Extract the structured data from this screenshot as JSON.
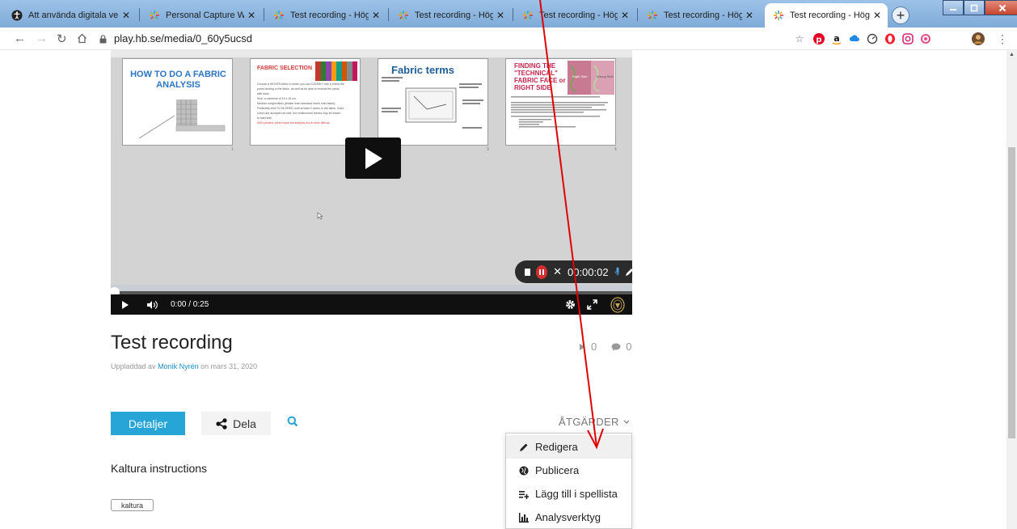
{
  "browser": {
    "tabs": [
      {
        "title": "Att använda digitala ver",
        "favicon": "accessibility-icon"
      },
      {
        "title": "Personal Capture Walkt",
        "favicon": "kaltura-icon"
      },
      {
        "title": "Test recording - Högsk",
        "favicon": "kaltura-icon"
      },
      {
        "title": "Test recording - Högsk",
        "favicon": "kaltura-icon"
      },
      {
        "title": "Test recording - Högsk",
        "favicon": "kaltura-icon"
      },
      {
        "title": "Test recording - Högsk",
        "favicon": "kaltura-icon"
      },
      {
        "title": "Test recording - Högsk",
        "favicon": "kaltura-icon",
        "active": true
      }
    ],
    "tab_close_glyph": "✕",
    "new_tab_glyph": "+",
    "url": "play.hb.se/media/0_60y5ucsd"
  },
  "player": {
    "slides": [
      {
        "title": "HOW TO DO A FABRIC ANALYSIS",
        "number": "1"
      },
      {
        "title": "FABRIC SELECTION",
        "number": "2",
        "bullets": [
          "Choose a WOVEN fabric in which you can CLEARLY see & follow the",
          "yarns binding in the fabric, as well as be able to remove the yarns",
          "with ease",
          "",
          "Size: a minimum of 15 x 15 cm.",
          "",
          "Medium weight fabric (thicker than standard man's shirt fabric).",
          "",
          "Preferably MULTICOLORED, with at least 2 colors in the fabric. Solid",
          "colors are accepted as well, but multicolored fabrics may be easier",
          "to start with.",
          "",
          "NON-printed, prints make the analysis much more difficult."
        ]
      },
      {
        "title": "Fabric terms",
        "number": "3"
      },
      {
        "title": "FINDING THE \"TECHNICAL\" FABRIC FACE or RIGHT SIDE",
        "number": "4",
        "label_right": "Right Side",
        "label_wrong": "Wrong Side"
      }
    ],
    "recorder_time": "00:00:02",
    "time_current": "0:00",
    "time_total": "/ 0:25"
  },
  "entry": {
    "title": "Test recording",
    "plays": "0",
    "comments": "0",
    "uploaded_prefix": "Uppladdad av",
    "author": "Monik Nyrén",
    "uploaded_suffix": "on mars 31, 2020"
  },
  "tabs": {
    "details": "Detaljer",
    "share": "Dela"
  },
  "actions": {
    "label": "ÅTGÄRDER",
    "items": [
      {
        "label": "Redigera",
        "icon": "pencil-icon"
      },
      {
        "label": "Publicera",
        "icon": "globe-icon"
      },
      {
        "label": "Lägg till i spellista",
        "icon": "playlist-add-icon"
      },
      {
        "label": "Analysverktyg",
        "icon": "bar-chart-icon"
      }
    ]
  },
  "description": "Kaltura instructions",
  "tags": [
    "kaltura"
  ],
  "colors": {
    "accent": "#26a5d6",
    "annotation_arrow": "#e00000"
  }
}
